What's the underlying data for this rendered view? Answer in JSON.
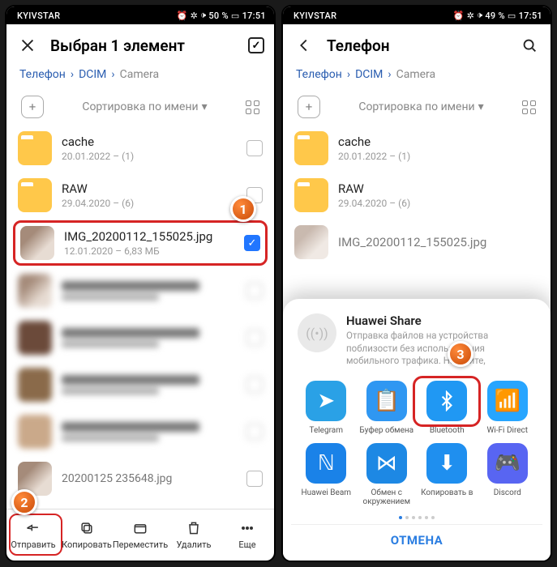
{
  "statusbar": {
    "carrier": "KYIVSTAR",
    "battery": "50 %",
    "battery_r": "49 %",
    "time": "17:51"
  },
  "header": {
    "selection_title": "Выбран 1 элемент",
    "browse_title": "Телефон"
  },
  "crumbs": {
    "a": "Телефон",
    "b": "DCIM",
    "c": "Camera"
  },
  "sort": {
    "label": "Сортировка по имени"
  },
  "rows": {
    "cache": {
      "name": "cache",
      "sub": "20.01.2022 – (1)"
    },
    "raw": {
      "name": "RAW",
      "sub": "29.04.2020 – (6)"
    },
    "img": {
      "name": "IMG_20200112_155025.jpg",
      "sub": "12.01.2020 – 6,83 МБ"
    },
    "img_r": {
      "name": "IMG_20200112_155025.jpg"
    },
    "tail": "2020012‍5  235648.jpg"
  },
  "toolbar": {
    "send": "Отправить",
    "copy": "Копировать",
    "move": "Переместить",
    "delete": "Удалить",
    "more": "Еще"
  },
  "sheet": {
    "hs_title": "Huawei Share",
    "hs_desc": "Отправка файлов на устройства поблизости без использования мобильного трафика. Нажмите,",
    "apps": {
      "telegram": "Telegram",
      "clipboard": "Буфер обмена",
      "bluetooth": "Bluetooth",
      "wifidirect": "Wi-Fi Direct",
      "hbeam": "Huawei Beam",
      "exchange": "Обмен с окружением",
      "copyto": "Копировать в",
      "discord": "Discord"
    },
    "cancel": "ОТМЕНА"
  },
  "steps": {
    "s1": "1",
    "s2": "2",
    "s3": "3"
  }
}
